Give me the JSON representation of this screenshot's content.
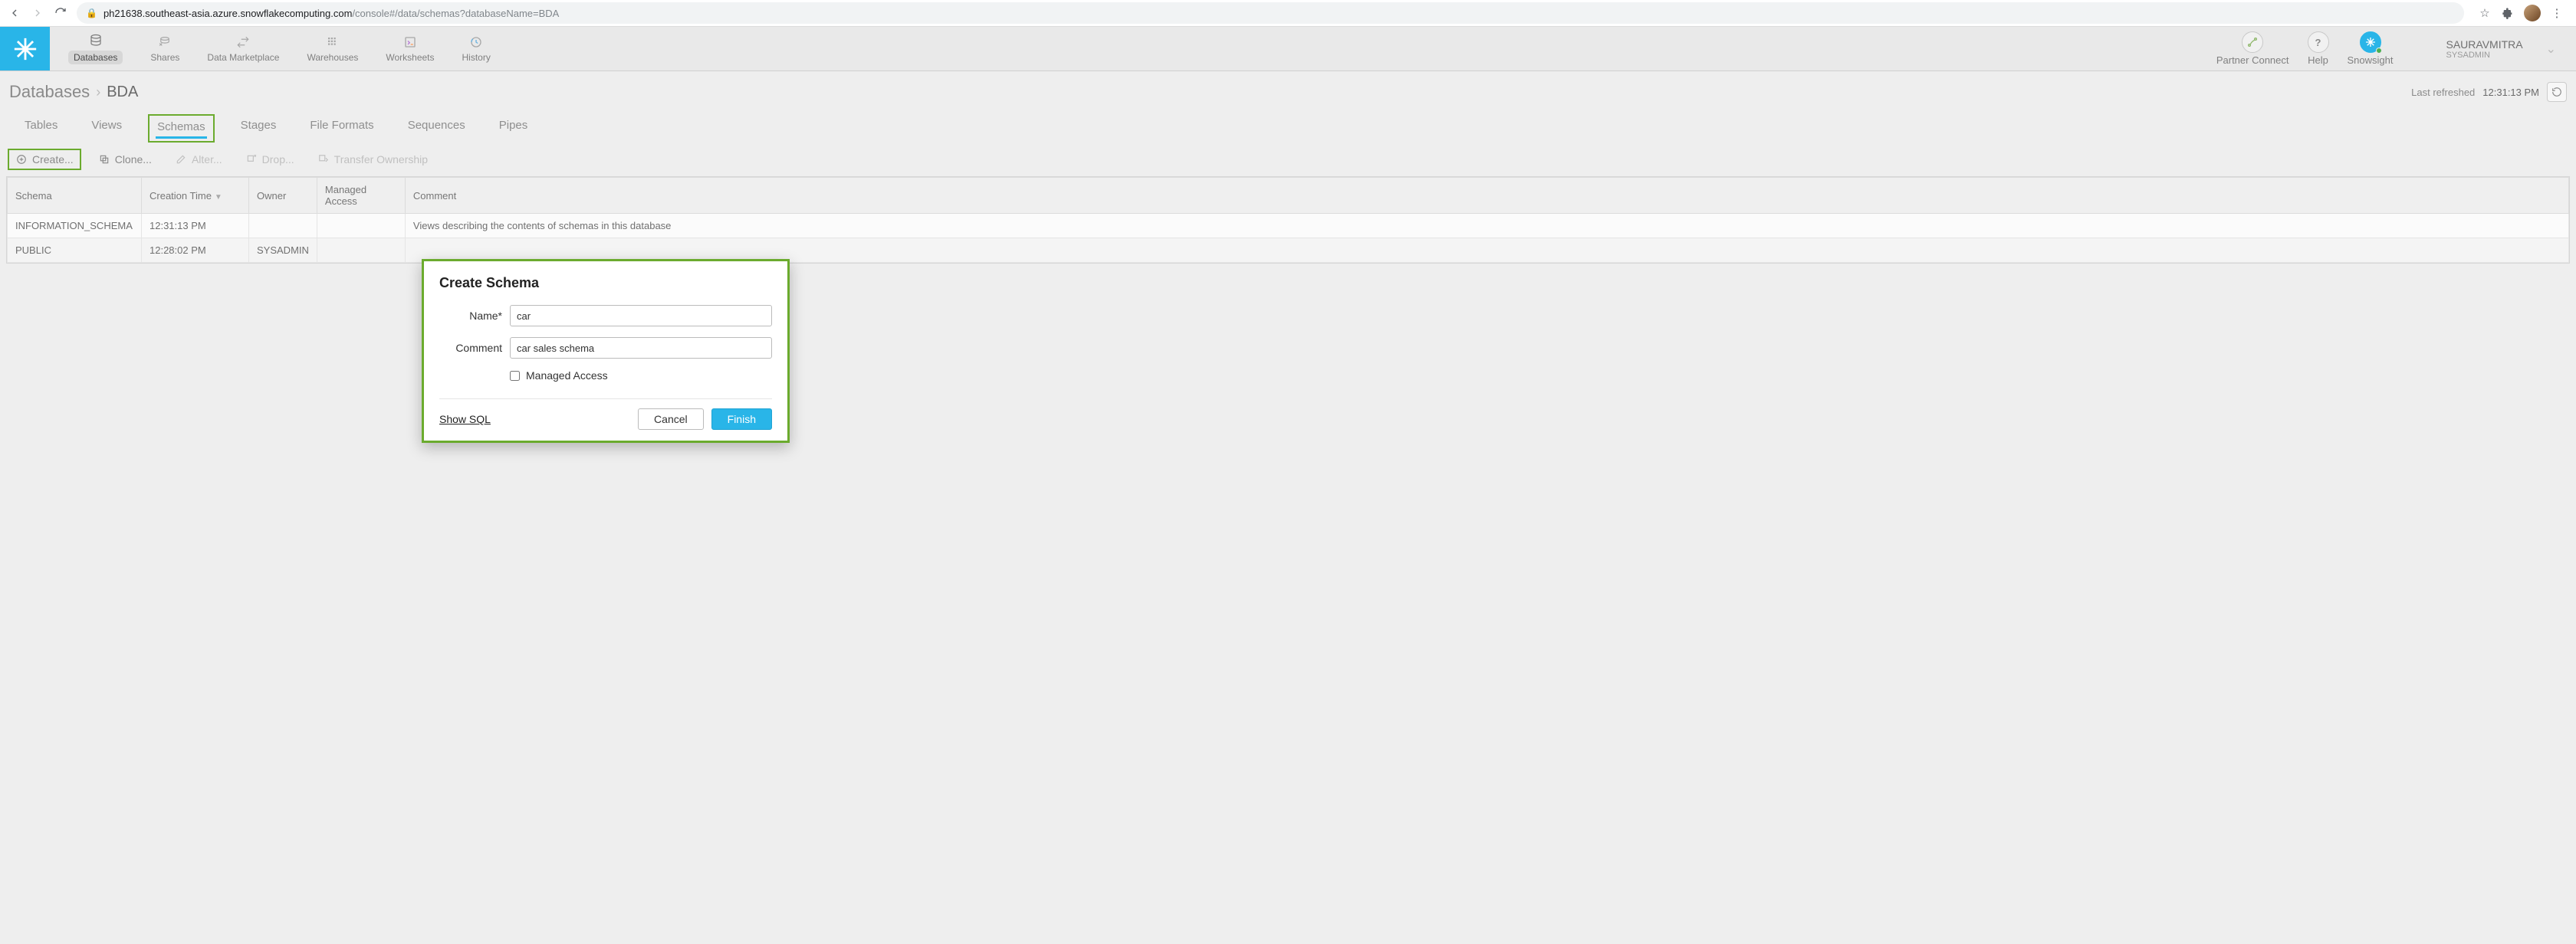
{
  "browser": {
    "url_host": "ph21638.southeast-asia.azure.snowflakecomputing.com",
    "url_path": "/console#/data/schemas?databaseName=BDA"
  },
  "nav": {
    "databases": "Databases",
    "shares": "Shares",
    "marketplace": "Data Marketplace",
    "warehouses": "Warehouses",
    "worksheets": "Worksheets",
    "history": "History",
    "partner": "Partner Connect",
    "help": "Help",
    "snowsight": "Snowsight"
  },
  "user": {
    "name": "SAURAVMITRA",
    "role": "SYSADMIN"
  },
  "crumb": {
    "root": "Databases",
    "current": "BDA"
  },
  "refresh": {
    "label": "Last refreshed",
    "time": "12:31:13 PM"
  },
  "subtabs": {
    "tables": "Tables",
    "views": "Views",
    "schemas": "Schemas",
    "stages": "Stages",
    "fileformats": "File Formats",
    "sequences": "Sequences",
    "pipes": "Pipes"
  },
  "actions": {
    "create": "Create...",
    "clone": "Clone...",
    "alter": "Alter...",
    "drop": "Drop...",
    "transfer": "Transfer Ownership"
  },
  "columns": {
    "schema": "Schema",
    "ctime": "Creation Time",
    "owner": "Owner",
    "managed": "Managed Access",
    "comment": "Comment"
  },
  "rows": [
    {
      "schema": "INFORMATION_SCHEMA",
      "ctime": "12:31:13 PM",
      "owner": "",
      "managed": "",
      "comment": "Views describing the contents of schemas in this database"
    },
    {
      "schema": "PUBLIC",
      "ctime": "12:28:02 PM",
      "owner": "SYSADMIN",
      "managed": "",
      "comment": ""
    }
  ],
  "modal": {
    "title": "Create Schema",
    "name_label": "Name*",
    "name_value": "car",
    "comment_label": "Comment",
    "comment_value": "car sales schema",
    "managed_label": "Managed Access",
    "showsql": "Show SQL",
    "cancel": "Cancel",
    "finish": "Finish"
  }
}
